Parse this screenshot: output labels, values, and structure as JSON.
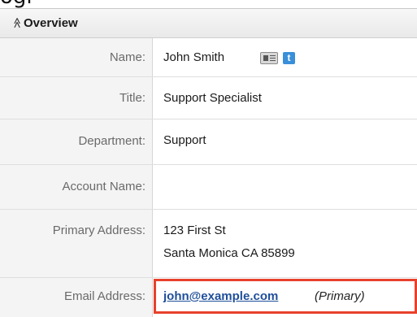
{
  "caption_fragment": "ogi",
  "panel": {
    "chevron_glyph": "≪",
    "title": "Overview"
  },
  "fields": {
    "name": {
      "label": "Name:",
      "value": "John Smith"
    },
    "title": {
      "label": "Title:",
      "value": "Support Specialist"
    },
    "department": {
      "label": "Department:",
      "value": "Support"
    },
    "account_name": {
      "label": "Account Name:",
      "value": ""
    },
    "primary_address": {
      "label": "Primary Address:",
      "line1": "123 First St",
      "line2": "Santa Monica CA  85899"
    },
    "email": {
      "label": "Email Address:",
      "value": "john@example.com",
      "tag": "(Primary)"
    }
  },
  "icons": [
    "vcard-icon",
    "twitter-icon"
  ],
  "colors": {
    "highlight": "#e8412c",
    "link": "#1f4f9a",
    "twitter": "#3a8fd9"
  }
}
